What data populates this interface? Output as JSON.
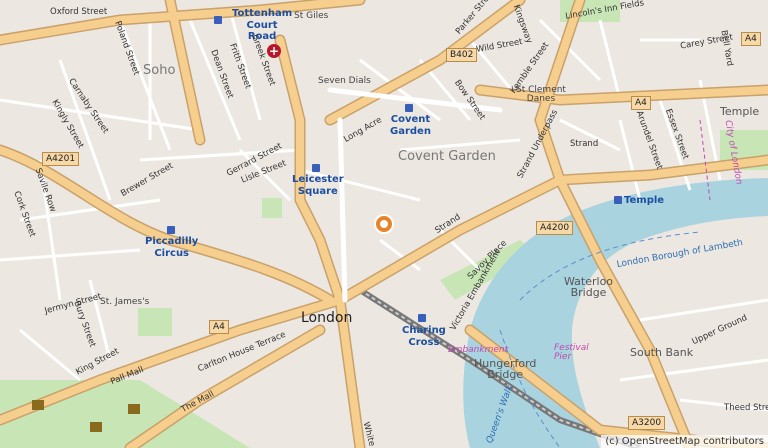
{
  "map": {
    "attribution": "(c) OpenStreetMap contributors",
    "colors": {
      "background": "#ece7e1",
      "major_road": "#f6cf8f",
      "road_casing": "#c9a16a",
      "minor_road": "#ffffff",
      "water": "#a9d3df",
      "park": "#c8e6b5",
      "station": "#1c4fa0",
      "marker": "#e8832b"
    },
    "marker": {
      "icon": "location-pin-icon"
    },
    "labels": {
      "oxford_street": "Oxford Street",
      "tottenham_court_road": "Tottenham\nCourt\nRoad",
      "st_giles": "St Giles",
      "soho": "Soho",
      "seven_dials": "Seven Dials",
      "covent_garden_station": "Covent\nGarden",
      "covent_garden_area": "Covent Garden",
      "leicester_square": "Leicester\nSquare",
      "piccadilly_circus": "Piccadilly\nCircus",
      "london": "London",
      "charing_cross": "Charing\nCross",
      "hungerford_bridge": "Hungerford\nBridge",
      "waterloo_bridge": "Waterloo\nBridge",
      "south_bank": "South Bank",
      "temple_area": "Temple",
      "temple_station": "Temple",
      "st_clement_danes": "St Clement\nDanes",
      "st_james": "St. James's",
      "long_acre": "Long Acre",
      "strand": "Strand",
      "strand_2": "Strand",
      "strand_underpass": "Strand Underpass",
      "victoria_embankment": "Victoria Embankment",
      "the_mall": "The Mall",
      "pall_mall": "Pall Mall",
      "jermyn_street": "Jermyn Street",
      "king_street": "King Street",
      "bury_street": "Bury Street",
      "carlton_house_terrace": "Carlton House Terrace",
      "savoy_place": "Savoy Place",
      "gerrard_street": "Gerrard Street",
      "lisle_street": "Lisle Street",
      "brewer_street": "Brewer Street",
      "carnaby_street": "Carnaby Street",
      "kingly_street": "Kingly Street",
      "savile_row": "Savile Row",
      "cork_street": "Cork Street",
      "poland_street": "Poland Street",
      "dean_street": "Dean Street",
      "frith_street": "Frith Street",
      "greek_street": "Greek Street",
      "wild_street": "Wild Street",
      "kemble_street": "Kemble Street",
      "bow_street": "Bow Street",
      "parker_street": "Parker Street",
      "lincolns_inn_fields": "Lincoln's Inn Fields",
      "carey_street": "Carey Street",
      "bell_yard": "Bell Yard",
      "arundel_street": "Arundel Street",
      "essex_street": "Essex Street",
      "upper_ground": "Upper Ground",
      "theed_street": "Theed Street",
      "embankment_pier": "Embankment",
      "festival_pier": "Festival\nPier",
      "borough_lambeth": "London Borough of Lambeth",
      "city_of_london": "City of London",
      "kingsway": "Kingsway",
      "white": "White",
      "queens_walk": "Queen's Walk"
    },
    "shields": {
      "a4201": "A4201",
      "b402": "B402",
      "a4_ne": "A4",
      "a4_e": "A4",
      "a4_sw": "A4",
      "a4200": "A4200",
      "a3200": "A3200"
    }
  }
}
